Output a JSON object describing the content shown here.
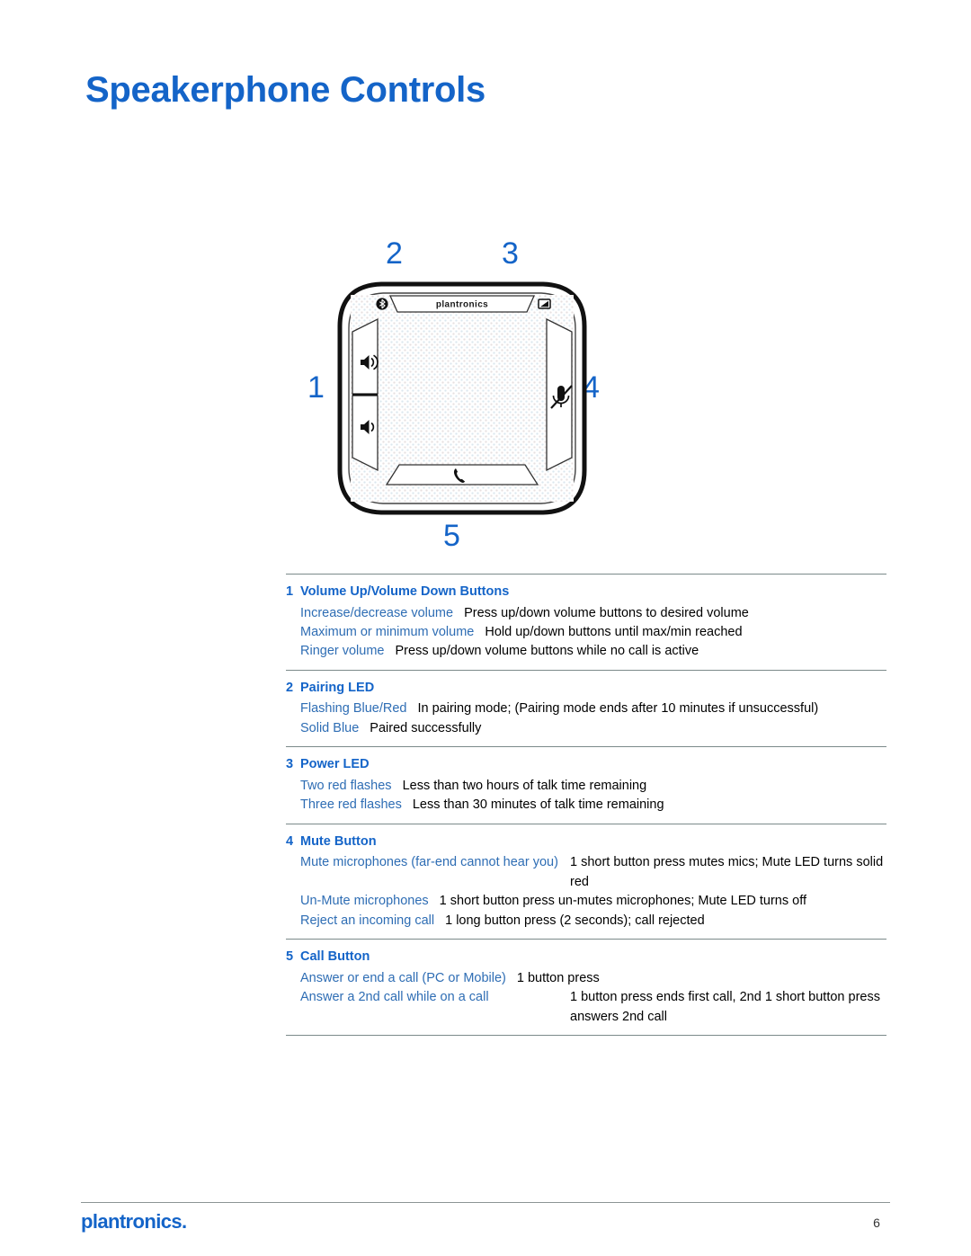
{
  "page": {
    "title": "Speakerphone Controls",
    "number": "6",
    "brand": "plantronics."
  },
  "diagram": {
    "device_brand": "plantronics",
    "callouts": [
      {
        "num": "1",
        "target": "volume-up-down-buttons"
      },
      {
        "num": "2",
        "target": "pairing-led"
      },
      {
        "num": "3",
        "target": "power-led"
      },
      {
        "num": "4",
        "target": "mute-button"
      },
      {
        "num": "5",
        "target": "call-button"
      }
    ],
    "icons": {
      "bluetooth": "bluetooth-icon",
      "power": "power-battery-icon",
      "volume_up": "volume-up-icon",
      "volume_down": "volume-down-icon",
      "mute": "mute-microphone-icon",
      "call": "phone-handset-icon"
    }
  },
  "sections": [
    {
      "num": "1",
      "title": "Volume Up/Volume Down Buttons",
      "rows": [
        {
          "label": "Increase/decrease volume",
          "desc": "Press up/down volume buttons to desired volume",
          "layout": "auto"
        },
        {
          "label": "Maximum or minimum volume",
          "desc": "Hold up/down buttons until max/min reached",
          "layout": "auto"
        },
        {
          "label": "Ringer volume",
          "desc": "Press up/down volume buttons while no call is active",
          "layout": "auto"
        }
      ]
    },
    {
      "num": "2",
      "title": "Pairing LED",
      "rows": [
        {
          "label": "Flashing Blue/Red",
          "desc": "In pairing mode; (Pairing mode ends after 10 minutes if unsuccessful)",
          "layout": "auto"
        },
        {
          "label": "Solid Blue",
          "desc": "Paired successfully",
          "layout": "auto"
        }
      ]
    },
    {
      "num": "3",
      "title": "Power LED",
      "rows": [
        {
          "label": "Two red flashes",
          "desc": "Less than two hours of talk time remaining",
          "layout": "auto"
        },
        {
          "label": "Three red flashes",
          "desc": "Less than 30 minutes of talk time remaining",
          "layout": "auto"
        }
      ]
    },
    {
      "num": "4",
      "title": "Mute Button",
      "rows": [
        {
          "label": "Mute microphones (far-end cannot hear you)",
          "desc": "1 short button press mutes mics; Mute LED turns solid red",
          "layout": "fixed"
        },
        {
          "label": "Un-Mute microphones",
          "desc": "1 short button press un-mutes microphones; Mute LED turns off",
          "layout": "auto"
        },
        {
          "label": "Reject an incoming call",
          "desc": "1 long button press (2 seconds); call rejected",
          "layout": "auto"
        }
      ]
    },
    {
      "num": "5",
      "title": "Call Button",
      "rows": [
        {
          "label": "Answer or end a call (PC or Mobile)",
          "desc": "1 button press",
          "layout": "auto"
        },
        {
          "label": "Answer a 2nd call while on a call",
          "desc": "1 button press ends first call, 2nd 1 short button press answers 2nd call",
          "layout": "fixed"
        }
      ]
    }
  ],
  "colors": {
    "title_blue": "#1464c8",
    "label_blue": "#2e6db4",
    "rule_gray": "#7b8a8a",
    "body_black": "#000000"
  }
}
